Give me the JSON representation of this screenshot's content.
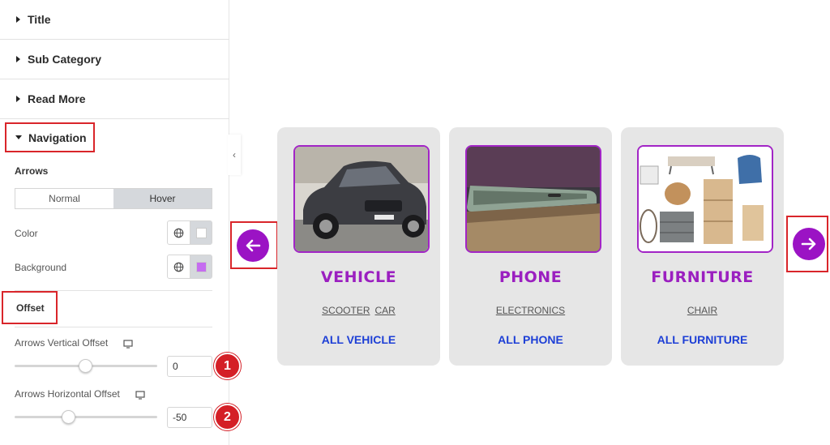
{
  "panel": {
    "sections": [
      "Title",
      "Sub Category",
      "Read More"
    ],
    "navigation_label": "Navigation",
    "arrows_label": "Arrows",
    "tabs": [
      "Normal",
      "Hover"
    ],
    "color_label": "Color",
    "background_label": "Background",
    "colors": {
      "arrow_color": "#ffffff",
      "arrow_background": "#c56cf0"
    },
    "offset_label": "Offset",
    "vertical_offset": {
      "label": "Arrows Vertical Offset",
      "value": "0",
      "badge": "1"
    },
    "horizontal_offset": {
      "label": "Arrows Horizontal Offset",
      "value": "-50",
      "badge": "2"
    }
  },
  "cards": [
    {
      "title": "VEHICLE",
      "subcategories": [
        "SCOOTER",
        "CAR"
      ],
      "link": "ALL VEHICLE",
      "image": "car-photo"
    },
    {
      "title": "PHONE",
      "subcategories": [
        "ELECTRONICS"
      ],
      "link": "ALL PHONE",
      "image": "phone-photo"
    },
    {
      "title": "FURNITURE",
      "subcategories": [
        "CHAIR"
      ],
      "link": "ALL FURNITURE",
      "image": "furniture-photo"
    }
  ],
  "theme": {
    "accent": "#9b13c4",
    "link": "#1d3fd6",
    "highlight": "#d9252a"
  }
}
